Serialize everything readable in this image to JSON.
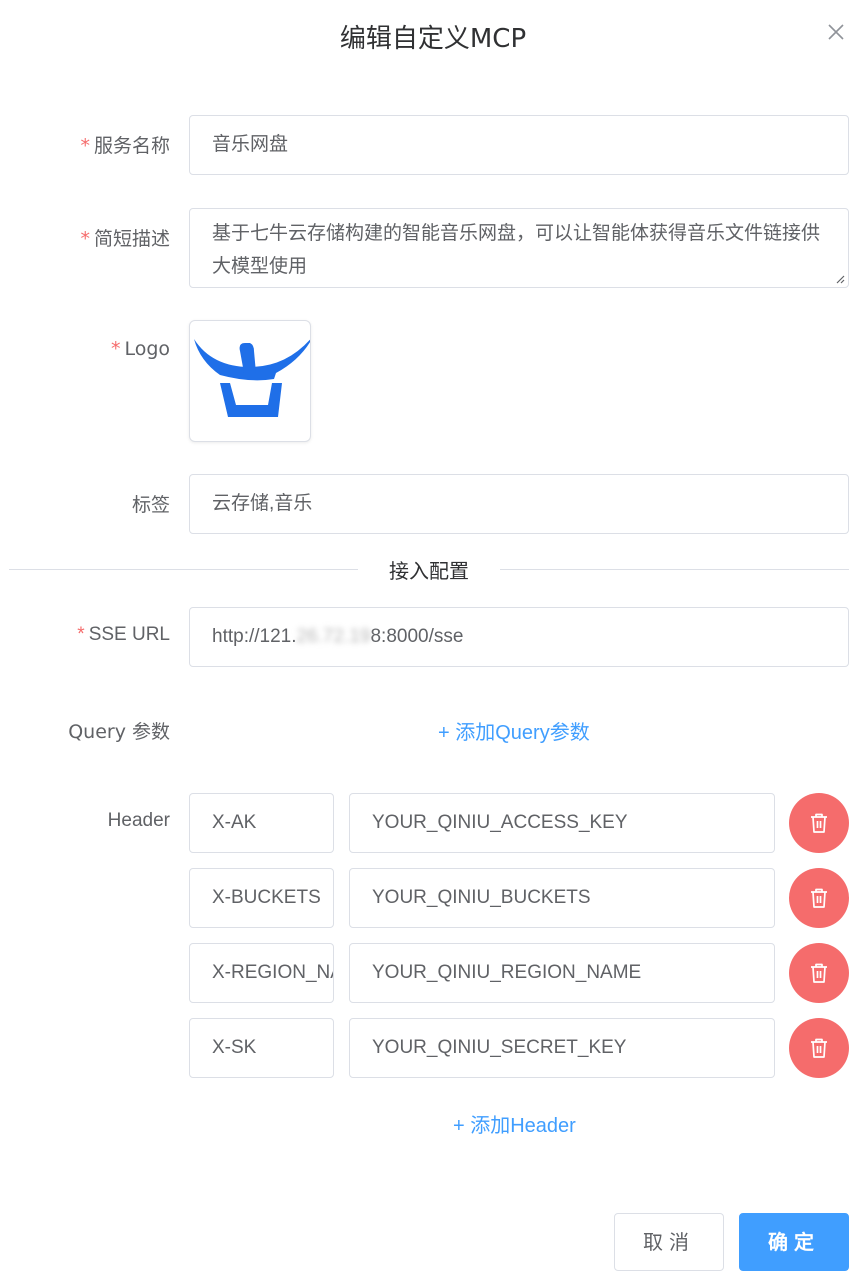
{
  "dialog": {
    "title": "编辑自定义MCP",
    "close_icon": "close-icon"
  },
  "form": {
    "required_mark": "*",
    "service_name": {
      "label": "服务名称",
      "value": "音乐网盘"
    },
    "description": {
      "label": "简短描述",
      "value": "基于七牛云存储构建的智能音乐网盘，可以让智能体获得音乐文件链接供大模型使用"
    },
    "logo": {
      "label": "Logo",
      "icon": "qiniu-logo"
    },
    "tags": {
      "label": "标签",
      "value": "云存储,音乐"
    },
    "section_title": "接入配置",
    "sse_url": {
      "label": "SSE URL",
      "value_prefix": "http://121.",
      "value_masked": "26.72.19",
      "value_suffix": "8:8000/sse"
    },
    "query": {
      "label": "Query 参数",
      "add_label": "+ 添加Query参数"
    },
    "header": {
      "label": "Header",
      "add_label": "+ 添加Header",
      "rows": [
        {
          "key": "X-AK",
          "value": "YOUR_QINIU_ACCESS_KEY"
        },
        {
          "key": "X-BUCKETS",
          "value": "YOUR_QINIU_BUCKETS"
        },
        {
          "key": "X-REGION_NAME",
          "value": "YOUR_QINIU_REGION_NAME"
        },
        {
          "key": "X-SK",
          "value": "YOUR_QINIU_SECRET_KEY"
        }
      ]
    }
  },
  "footer": {
    "cancel_label": "取消",
    "confirm_label": "确定"
  },
  "colors": {
    "primary": "#409eff",
    "danger": "#f56c6c",
    "required": "#f56c6c",
    "logo_blue": "#1f6fe8"
  }
}
